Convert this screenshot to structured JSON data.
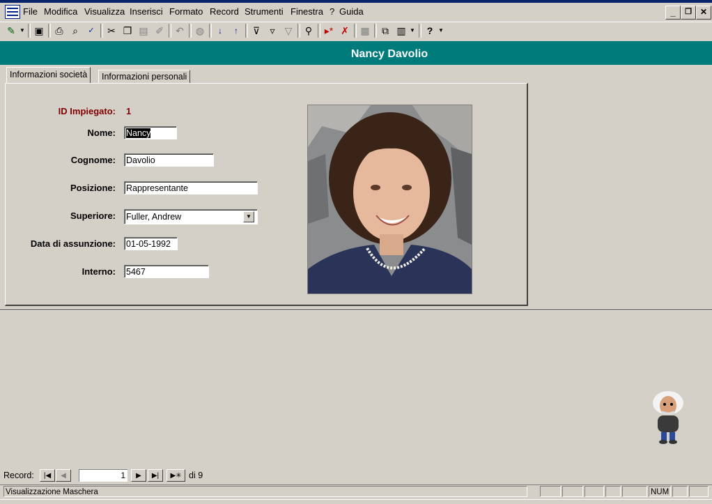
{
  "menu": {
    "items": [
      "File",
      "Modifica",
      "Visualizza",
      "Inserisci",
      "Formato",
      "Record",
      "Strumenti",
      "Finestra",
      "?",
      "Guida"
    ]
  },
  "window_controls": {
    "minimize": "_",
    "restore": "❐",
    "close": "✕"
  },
  "toolbar": {
    "icons": [
      "view-design-icon",
      "save-icon",
      "print-icon",
      "print-preview-icon",
      "spelling-icon",
      "cut-icon",
      "copy-icon",
      "paste-icon",
      "format-painter-icon",
      "undo-icon",
      "hyperlink-icon",
      "sort-ascending-icon",
      "sort-descending-icon",
      "filter-by-selection-icon",
      "filter-by-form-icon",
      "apply-filter-icon",
      "find-icon",
      "new-record-icon",
      "delete-record-icon",
      "properties-icon",
      "database-window-icon",
      "new-object-icon",
      "help-icon"
    ]
  },
  "header": {
    "title": "Nancy Davolio",
    "color": "#007b7b"
  },
  "tabs": [
    {
      "label": "Informazioni società",
      "active": true
    },
    {
      "label": "Informazioni personali",
      "active": false
    }
  ],
  "form": {
    "id_label": "ID Impiegato:",
    "id_value": "1",
    "id_color": "#800000",
    "fields": [
      {
        "label": "Nome:",
        "value": "Nancy"
      },
      {
        "label": "Cognome:",
        "value": "Davolio"
      },
      {
        "label": "Posizione:",
        "value": "Rappresentante"
      },
      {
        "label": "Superiore:",
        "value": "Fuller, Andrew"
      },
      {
        "label": "Data di assunzione:",
        "value": "01-05-1992"
      },
      {
        "label": "Interno:",
        "value": "5467"
      }
    ]
  },
  "navigator": {
    "label": "Record:",
    "current": "1",
    "total_text": "di 9"
  },
  "status": {
    "text": "Visualizzazione Maschera",
    "indicator": "NUM"
  }
}
